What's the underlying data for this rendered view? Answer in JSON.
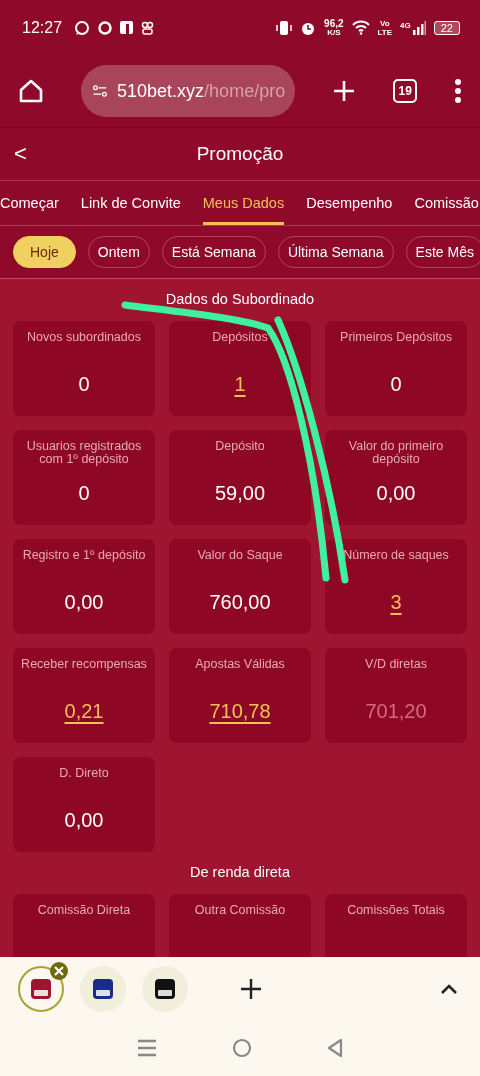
{
  "status_bar": {
    "time": "12:27",
    "speed": "96,2",
    "speed_unit": "K/S",
    "volte_top": "Vo",
    "volte_bottom": "LTE",
    "network": "4G",
    "battery": "22"
  },
  "browser": {
    "url_host": "510bet.xyz",
    "url_path": "/home/pro",
    "tab_count": "19"
  },
  "header": {
    "back": "<",
    "title": "Promoção"
  },
  "tabs": [
    {
      "label": "Começar",
      "selected": false
    },
    {
      "label": "Link de Convite",
      "selected": false
    },
    {
      "label": "Meus Dados",
      "selected": true
    },
    {
      "label": "Desempenho",
      "selected": false
    },
    {
      "label": "Comissão",
      "selected": false
    }
  ],
  "periods": [
    {
      "label": "Hoje",
      "selected": true
    },
    {
      "label": "Ontem",
      "selected": false
    },
    {
      "label": "Está Semana",
      "selected": false
    },
    {
      "label": "Última Semana",
      "selected": false
    },
    {
      "label": "Este Mês",
      "selected": false
    }
  ],
  "sections": [
    {
      "title": "Dados do Subordinado",
      "cards": [
        {
          "label": "Novos subordinados",
          "value": "0",
          "kind": "plain"
        },
        {
          "label": "Depósitos",
          "value": "1",
          "kind": "link"
        },
        {
          "label": "Primeiros Depósitos",
          "value": "0",
          "kind": "plain"
        },
        {
          "label": "Usuarios registrados com 1º depósito",
          "value": "0",
          "kind": "plain"
        },
        {
          "label": "Depósito",
          "value": "59,00",
          "kind": "plain"
        },
        {
          "label": "Valor do primeiro depósito",
          "value": "0,00",
          "kind": "plain"
        },
        {
          "label": "Registro e 1º depósito",
          "value": "0,00",
          "kind": "plain"
        },
        {
          "label": "Valor do Saque",
          "value": "760,00",
          "kind": "plain"
        },
        {
          "label": "Número de saques",
          "value": "3",
          "kind": "link"
        },
        {
          "label": "Receber recompensas",
          "value": "0,21",
          "kind": "link"
        },
        {
          "label": "Apostas Válidas",
          "value": "710,78",
          "kind": "link"
        },
        {
          "label": "V/D diretas",
          "value": "701,20",
          "kind": "muted"
        },
        {
          "label": "D. Direto",
          "value": "0,00",
          "kind": "plain"
        }
      ]
    },
    {
      "title": "De renda direta",
      "cards": [
        {
          "label": "Comissão Direta"
        },
        {
          "label": "Outra Comissão"
        },
        {
          "label": "Comissões Totais"
        }
      ]
    }
  ],
  "open_tabs": [
    {
      "selected": true
    },
    {
      "selected": false
    },
    {
      "selected": false
    }
  ]
}
